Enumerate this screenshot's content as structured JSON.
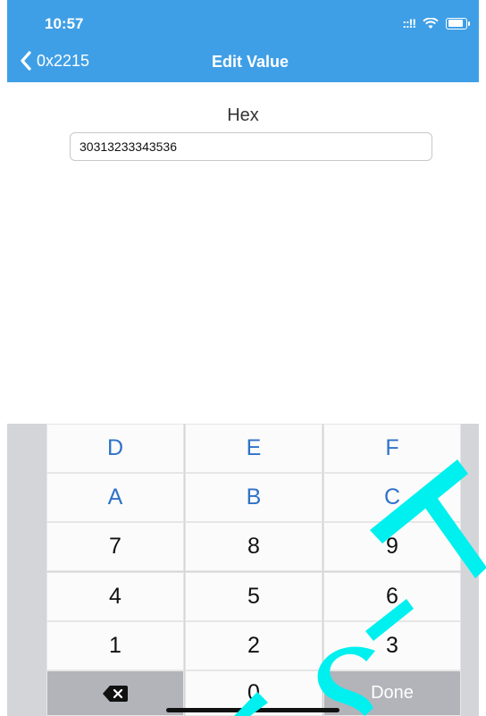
{
  "status": {
    "time": "10:57",
    "signal": "::!!"
  },
  "nav": {
    "back_label": "0x2215",
    "title": "Edit Value"
  },
  "field": {
    "label": "Hex",
    "value": "30313233343536"
  },
  "keyboard": {
    "rows": [
      [
        "D",
        "E",
        "F"
      ],
      [
        "A",
        "B",
        "C"
      ],
      [
        "7",
        "8",
        "9"
      ],
      [
        "4",
        "5",
        "6"
      ],
      [
        "1",
        "2",
        "3"
      ]
    ],
    "zero": "0",
    "done": "Done",
    "delete_icon": "backspace-icon"
  },
  "watermark": {
    "text": "TEST",
    "color": "#00f0f0"
  },
  "colors": {
    "header": "#3f9fe6",
    "hex_key_text": "#2f72c9"
  }
}
